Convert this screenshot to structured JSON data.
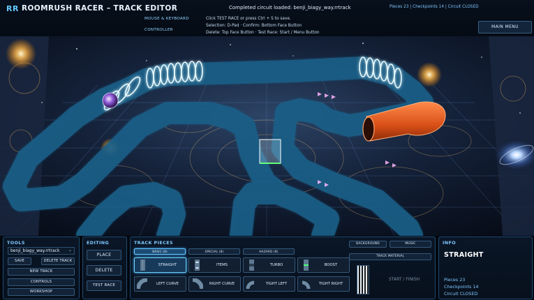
{
  "header": {
    "logo": "RR",
    "title": "ROOMRUSH RACER – TRACK EDITOR",
    "controls_tabs": [
      "MOUSE & KEYBOARD",
      "CONTROLLER"
    ],
    "loaded_message": "Completed circuit loaded: benji_biagy_way.rrtrack",
    "help_lines": [
      "Click TEST RACE or press Ctrl + S to save.",
      "Selection: D-Pad · Confirm: Bottom Face Button",
      "Delete: Top Face Button · Test Race: Start / Menu Button"
    ],
    "status": "Pieces 23 | Checkpoints 14 | Circuit CLOSED",
    "main_menu_label": "MAIN MENU"
  },
  "tools": {
    "title": "TOOLS",
    "track_name": "benji_biagy_way.rrtrack",
    "buttons": [
      "SAVE",
      "DELETE TRACK",
      "NEW TRACK",
      "CONTROLS",
      "WORKSHOP"
    ]
  },
  "editing": {
    "title": "EDITING",
    "buttons": [
      "PLACE",
      "DELETE",
      "TEST RACE"
    ]
  },
  "track_pieces": {
    "title": "TRACK PIECES",
    "tabs": [
      "BASIC (8)",
      "SPECIAL (8)",
      "HAZARD (8)"
    ],
    "selected_tab": "BASIC (8)",
    "pieces": [
      {
        "label": "STRAIGHT",
        "icon": "straight-track-icon"
      },
      {
        "label": "ITEMS",
        "icon": "items-track-icon"
      },
      {
        "label": "TURBO",
        "icon": "turbo-track-icon"
      },
      {
        "label": "BOOST",
        "icon": "boost-track-icon"
      },
      {
        "label": "LEFT CURVE",
        "icon": "left-curve-icon"
      },
      {
        "label": "RIGHT CURVE",
        "icon": "right-curve-icon"
      },
      {
        "label": "TIGHT LEFT",
        "icon": "tight-left-icon"
      },
      {
        "label": "TIGHT RIGHT",
        "icon": "tight-right-icon"
      }
    ],
    "selected_piece": "STRAIGHT",
    "right_buttons": [
      "BACKGROUND",
      "MUSIC",
      "TRACK MATERIAL"
    ],
    "start_finish_label": "START / FINISH"
  },
  "info": {
    "title": "INFO",
    "selected_type": "STRAIGHT",
    "lines": [
      "Pieces 23",
      "Checkpoints 14",
      "Circuit CLOSED"
    ]
  },
  "colors": {
    "accent": "#67c8ff",
    "track_glow": "#9fe6ff",
    "tube_orange": "#e05a24",
    "panel_bg": "#0a1626"
  }
}
